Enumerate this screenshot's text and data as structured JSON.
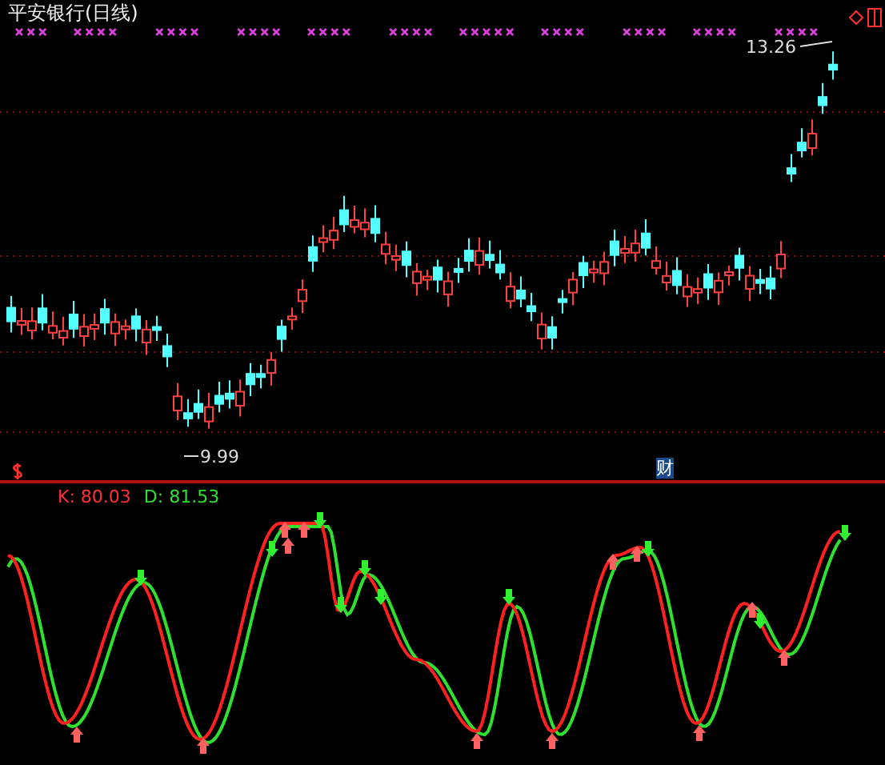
{
  "price_chart": {
    "title": "平安银行(日线)",
    "high_label": "13.26",
    "low_label": "9.99",
    "finance_marker": "财"
  },
  "indicator": {
    "k_label": "K: 80.03",
    "d_label": "D: 81.53"
  }
}
